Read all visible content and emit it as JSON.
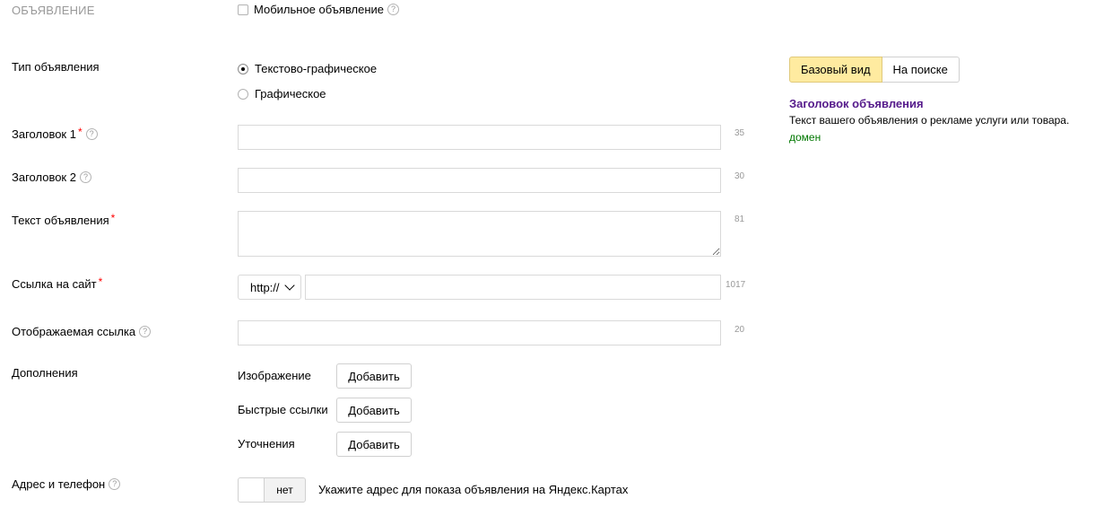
{
  "section": {
    "title": "Объявление"
  },
  "mobile": {
    "label": "Мобильное объявление",
    "help": "?"
  },
  "ad_type": {
    "label": "Тип объявления",
    "options": [
      {
        "label": "Текстово-графическое",
        "selected": true
      },
      {
        "label": "Графическое",
        "selected": false
      }
    ]
  },
  "fields": {
    "title1": {
      "label": "Заголовок 1",
      "required": "*",
      "help": "?",
      "value": "",
      "counter": "35"
    },
    "title2": {
      "label": "Заголовок 2",
      "help": "?",
      "value": "",
      "counter": "30"
    },
    "text": {
      "label": "Текст объявления",
      "required": "*",
      "value": "",
      "counter": "81"
    },
    "url": {
      "label": "Ссылка на сайт",
      "required": "*",
      "protocol": "http://",
      "value": "",
      "counter": "1017"
    },
    "display_url": {
      "label": "Отображаемая ссылка",
      "help": "?",
      "value": "",
      "counter": "20"
    }
  },
  "extras": {
    "label": "Дополнения",
    "items": [
      {
        "label": "Изображение",
        "button": "Добавить"
      },
      {
        "label": "Быстрые ссылки",
        "button": "Добавить"
      },
      {
        "label": "Уточнения",
        "button": "Добавить"
      }
    ]
  },
  "address": {
    "label": "Адрес и телефон",
    "help": "?",
    "toggle": "нет",
    "hint": "Укажите адрес для показа объявления на Яндекс.Картах"
  },
  "preview": {
    "tabs": [
      {
        "label": "Базовый вид",
        "active": true
      },
      {
        "label": "На поиске",
        "active": false
      }
    ],
    "title": "Заголовок объявления",
    "text": "Текст вашего объявления о рекламе услуги или товара.",
    "domain": "домен",
    "colors": {
      "title": "#551a8b",
      "domain": "#007700",
      "active_tab": "#ffeba0",
      "required": "#ff0000"
    }
  }
}
